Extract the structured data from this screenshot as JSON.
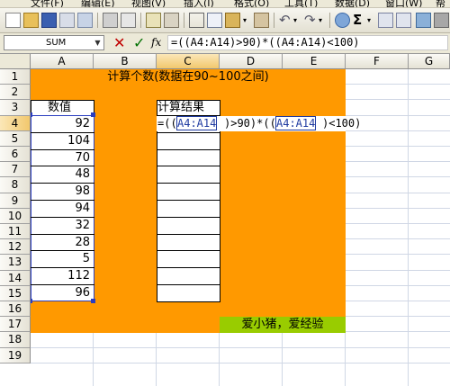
{
  "menubar": {
    "items": [
      "文件(F)",
      "编辑(E)",
      "视图(V)",
      "插入(I)",
      "格式(O)",
      "工具(T)",
      "数据(D)",
      "窗口(W)",
      "帮"
    ]
  },
  "toolbar": {
    "sigma": "Σ"
  },
  "formula_bar": {
    "name_box": "SUM",
    "cancel": "✕",
    "enter": "✓",
    "fx": "fx",
    "formula": "=((A4:A14)>90)*((A4:A14)<100)"
  },
  "columns": [
    "A",
    "B",
    "C",
    "D",
    "E",
    "F",
    "G"
  ],
  "rows": [
    "1",
    "2",
    "3",
    "4",
    "5",
    "6",
    "7",
    "8",
    "9",
    "10",
    "11",
    "12",
    "13",
    "14",
    "15",
    "16",
    "17",
    "18",
    "19"
  ],
  "sheet": {
    "title": "计算个数(数据在90~100之间)",
    "header_a": "数值",
    "header_c": "计算结果",
    "values": [
      "92",
      "104",
      "70",
      "48",
      "98",
      "94",
      "32",
      "28",
      "5",
      "112",
      "96"
    ],
    "edit_parts": [
      "=((",
      "A4:A14",
      ")>90)*((",
      "A4:A14",
      ")<100)"
    ],
    "footer_note": "爱小猪，爱经验"
  },
  "colors": {
    "orange": "#ff9900",
    "green": "#99cc00",
    "grid": "#d0d7e5",
    "ref_blue": "#1f3aa0"
  }
}
